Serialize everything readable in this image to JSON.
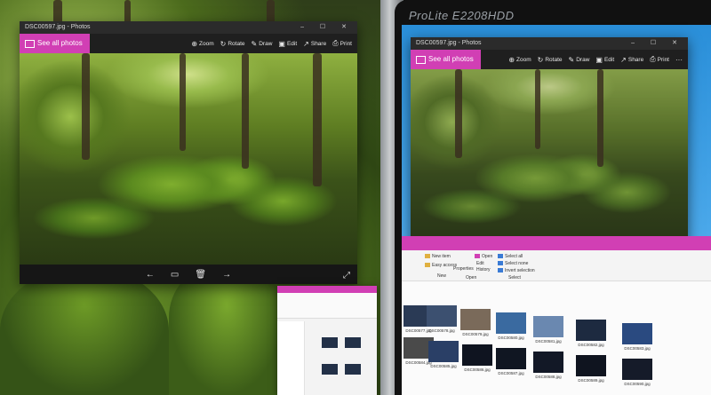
{
  "left_window": {
    "title": "DSC00597.jpg - Photos",
    "see_all": "See all photos",
    "tools": [
      {
        "icon": "zoom-icon",
        "glyph": "⊕",
        "label": "Zoom"
      },
      {
        "icon": "rotate-icon",
        "glyph": "↻",
        "label": "Rotate"
      },
      {
        "icon": "draw-icon",
        "glyph": "✎",
        "label": "Draw"
      },
      {
        "icon": "edit-icon",
        "glyph": "▣",
        "label": "Edit"
      },
      {
        "icon": "share-icon",
        "glyph": "↗",
        "label": "Share"
      },
      {
        "icon": "print-icon",
        "glyph": "⎙",
        "label": "Print"
      }
    ]
  },
  "right_window": {
    "title": "DSC00597.jpg - Photos",
    "see_all": "See all photos",
    "tools": [
      {
        "icon": "zoom-icon",
        "glyph": "⊕",
        "label": "Zoom"
      },
      {
        "icon": "rotate-icon",
        "glyph": "↻",
        "label": "Rotate"
      },
      {
        "icon": "draw-icon",
        "glyph": "✎",
        "label": "Draw"
      },
      {
        "icon": "edit-icon",
        "glyph": "▣",
        "label": "Edit"
      },
      {
        "icon": "share-icon",
        "glyph": "↗",
        "label": "Share"
      },
      {
        "icon": "print-icon",
        "glyph": "⎙",
        "label": "Print"
      }
    ],
    "more": "···"
  },
  "monitor_brand": "ProLite E2208HDD",
  "nav": {
    "prev": "←",
    "slideshow": "▭",
    "delete": "🗑",
    "next": "→",
    "expand": "⤢"
  },
  "window_controls": "– ☐ ✕",
  "explorer_ribbon": {
    "new_item": "New item",
    "easy_access": "Easy access",
    "properties": "Properties",
    "open": "Open",
    "edit": "Edit",
    "history": "History",
    "select_all": "Select all",
    "select_none": "Select none",
    "invert_selection": "Invert selection",
    "group_new": "New",
    "group_open": "Open",
    "group_select": "Select"
  },
  "files": [
    "DSC00577.jpg",
    "DSC00578.jpg",
    "DSC00579.jpg",
    "DSC00580.jpg",
    "DSC00581.jpg",
    "DSC00582.jpg",
    "DSC00583.jpg",
    "DSC00584.jpg",
    "DSC00585.jpg",
    "DSC00586.jpg",
    "DSC00587.jpg",
    "DSC00588.jpg",
    "DSC00589.jpg",
    "DSC00590.jpg"
  ],
  "colors": {
    "accent": "#d13fb4",
    "chrome": "#1f1f1f"
  }
}
